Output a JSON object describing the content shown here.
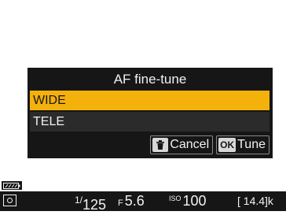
{
  "dialog": {
    "title": "AF fine-tune",
    "items": [
      {
        "label": "WIDE",
        "selected": true
      },
      {
        "label": "TELE",
        "selected": false
      }
    ],
    "buttons": {
      "cancel_label": "Cancel",
      "cancel_icon": "trash-icon",
      "tune_label": "Tune",
      "tune_icon_text": "OK"
    }
  },
  "status": {
    "battery_icon": "battery-icon",
    "metering_icon": "matrix-metering-icon",
    "shutter_numerator": "1/",
    "shutter_denominator": "125",
    "aperture_prefix": "F",
    "aperture_value": "5.6",
    "iso_label": "ISO",
    "iso_value": "100",
    "shots_remaining": "[ 14.4]k"
  },
  "colors": {
    "highlight": "#f4b10c",
    "dialog_bg": "#161616",
    "row_bg": "#2b2b2b",
    "text": "#f2f2f2"
  }
}
